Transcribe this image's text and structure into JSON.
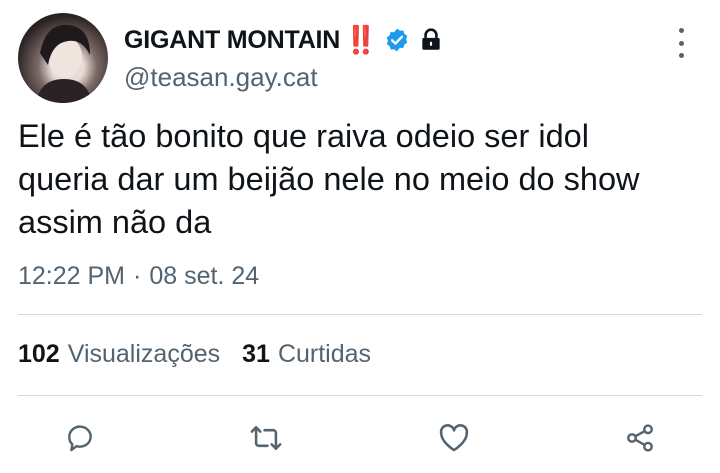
{
  "colors": {
    "text": "#0f1419",
    "secondary_text": "#536471",
    "verified_badge": "#1d9bf0",
    "alert_red": "#e0222b",
    "divider": "#cfd9de"
  },
  "author": {
    "display_name": "GIGANT MONTAIN",
    "emoji": "‼️",
    "handle": "@teasan.gay.cat",
    "verified_icon": "verified-badge-icon",
    "lock_icon": "lock-icon"
  },
  "tweet": {
    "lines": [
      "Ele é tão bonito que raiva odeio ser idol",
      "queria dar um beijão nele no meio do show",
      "assim não da"
    ],
    "time": "12:22 PM",
    "separator": "·",
    "date": "08 set. 24"
  },
  "stats": {
    "views_count": "102",
    "views_label": "Visualizações",
    "likes_count": "31",
    "likes_label": "Curtidas"
  },
  "actions": [
    "reply-icon",
    "retweet-icon",
    "like-icon",
    "share-icon"
  ],
  "menu": {
    "more_icon": "more-vertical-icon"
  }
}
